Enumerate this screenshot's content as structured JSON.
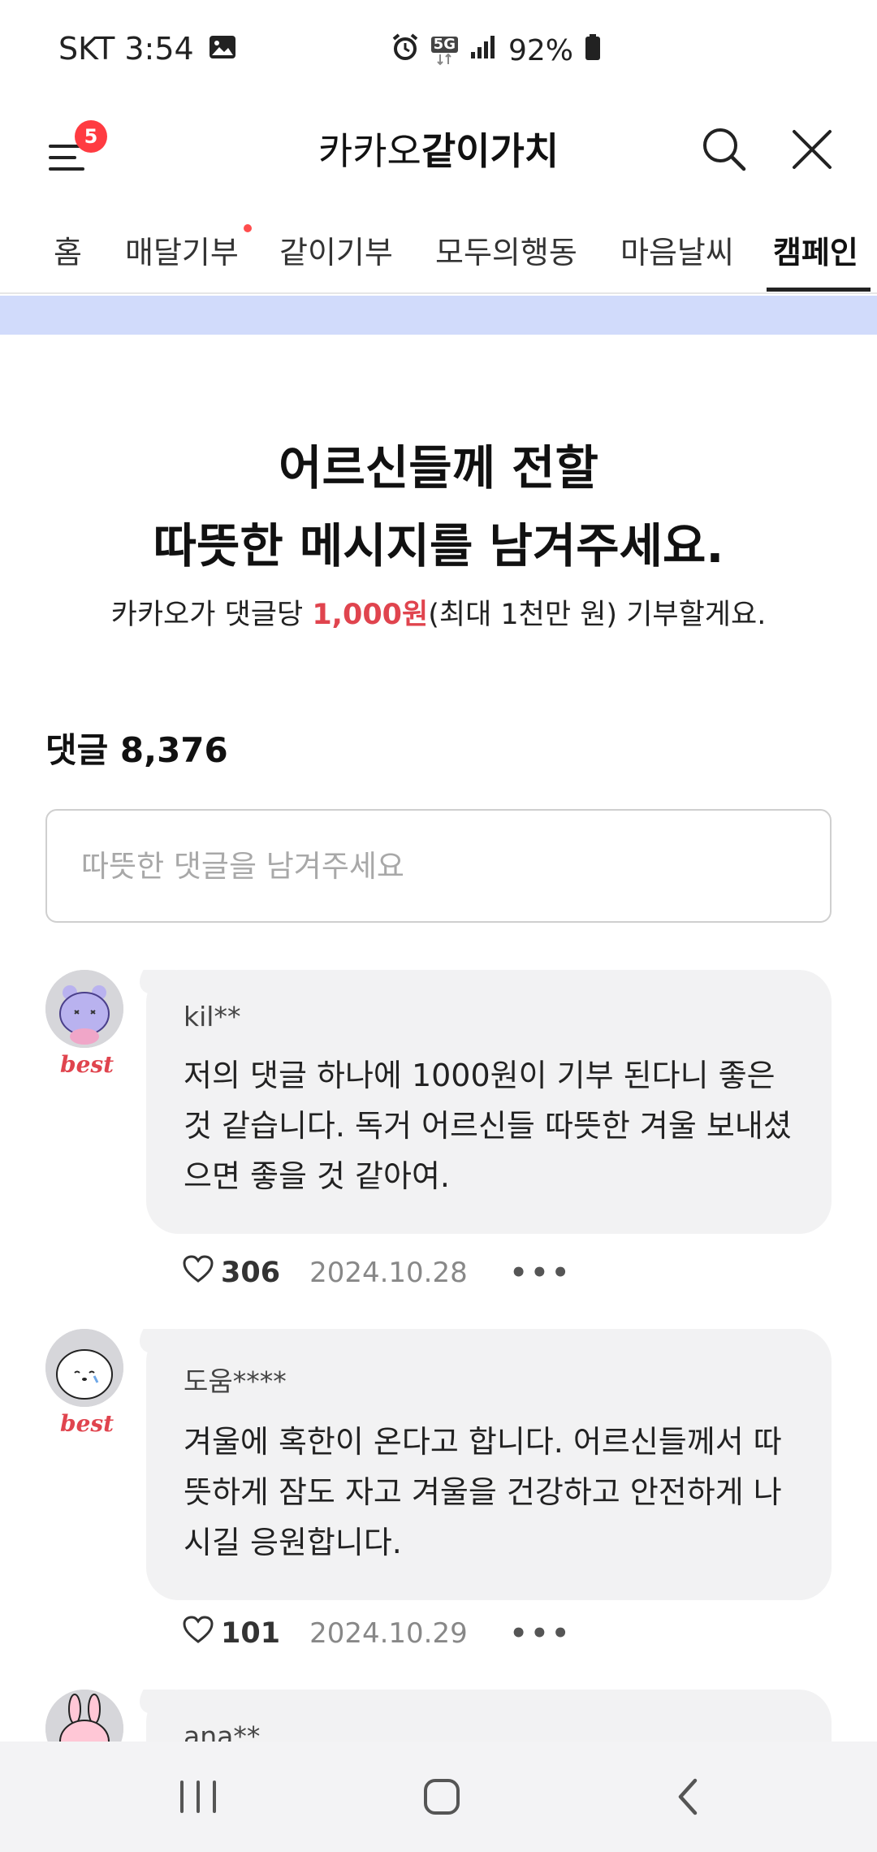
{
  "status_bar": {
    "carrier_time": "SKT 3:54",
    "network": "5G",
    "battery": "92%"
  },
  "header": {
    "notification_count": "5",
    "title_regular": "카카오",
    "title_bold": "같이가치"
  },
  "tabs": [
    {
      "label": "홈"
    },
    {
      "label": "매달기부"
    },
    {
      "label": "같이기부"
    },
    {
      "label": "모두의행동"
    },
    {
      "label": "마음날씨"
    },
    {
      "label": "캠페인"
    }
  ],
  "campaign": {
    "headline_line1": "어르신들께 전할",
    "headline_line2": "따뜻한 메시지를 남겨주세요.",
    "sub_prefix": "카카오가 댓글당 ",
    "sub_amount": "1,000원",
    "sub_suffix": "(최대 1천만 원) 기부할게요."
  },
  "comments_section": {
    "count_label": "댓글 8,376",
    "input_placeholder": "따뜻한 댓글을 남겨주세요"
  },
  "comments": [
    {
      "author": "kil**",
      "badge": "best",
      "text": "저의 댓글 하나에 1000원이 기부 된다니 좋은 것 같습니다. 독거 어르신들 따뜻한 겨울 보내셨으면 좋을 것 같아여.",
      "likes": "306",
      "date": "2024.10.28"
    },
    {
      "author": "도움****",
      "badge": "best",
      "text": "겨울에 혹한이 온다고 합니다. 어르신들께서 따뜻하게 잠도 자고 겨울을 건강하고 안전하게 나시길 응원합니다.",
      "likes": "101",
      "date": "2024.10.29"
    },
    {
      "author": "ana**"
    }
  ],
  "colors": {
    "accent_red": "#e0444e",
    "banner_blue": "#d1dbfb",
    "bubble_gray": "#f2f2f3"
  }
}
